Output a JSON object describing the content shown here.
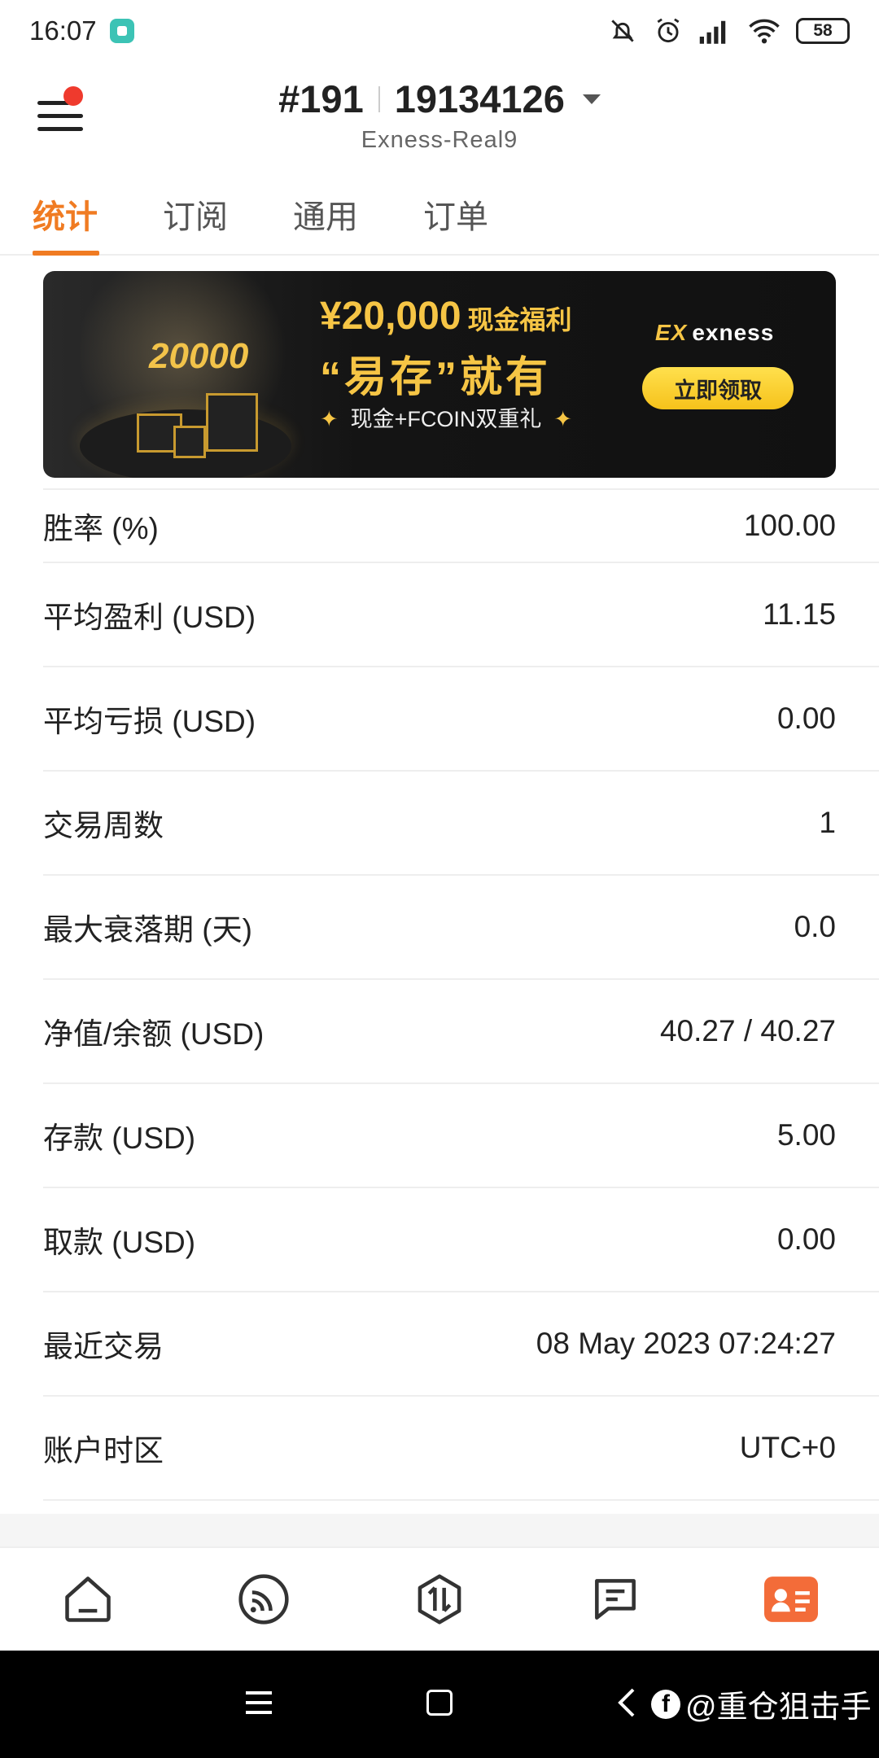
{
  "status_bar": {
    "time": "16:07",
    "battery": "58"
  },
  "header": {
    "account_prefix": "#191",
    "account_number": "19134126",
    "server": "Exness-Real9"
  },
  "tabs": [
    {
      "label": "统计",
      "active": true
    },
    {
      "label": "订阅",
      "active": false
    },
    {
      "label": "通用",
      "active": false
    },
    {
      "label": "订单",
      "active": false
    }
  ],
  "banner": {
    "amount": "¥20,000",
    "amount_suffix": "现金福利",
    "slogan": "“易存”就有",
    "subtitle": "现金+FCOIN双重礼",
    "coin_text": "20000",
    "brand": "exness",
    "cta": "立即领取"
  },
  "stats": [
    {
      "label": "胜率 (%)",
      "value": "100.00"
    },
    {
      "label": "平均盈利 (USD)",
      "value": "11.15"
    },
    {
      "label": "平均亏损 (USD)",
      "value": "0.00"
    },
    {
      "label": "交易周数",
      "value": "1"
    },
    {
      "label": "最大衰落期 (天)",
      "value": "0.0"
    },
    {
      "label": "净值/余额 (USD)",
      "value": "40.27 / 40.27"
    },
    {
      "label": "存款 (USD)",
      "value": "5.00"
    },
    {
      "label": "取款 (USD)",
      "value": "0.00"
    },
    {
      "label": "最近交易",
      "value": "08 May 2023 07:24:27"
    },
    {
      "label": "账户时区",
      "value": "UTC+0"
    }
  ],
  "bottom_nav": [
    {
      "icon": "home-icon",
      "active": false
    },
    {
      "icon": "signal-icon",
      "active": false
    },
    {
      "icon": "trade-icon",
      "active": false
    },
    {
      "icon": "message-icon",
      "active": false
    },
    {
      "icon": "profile-card-icon",
      "active": true
    }
  ],
  "watermark": "@重仓狙击手",
  "colors": {
    "accent": "#f07b22",
    "badge_red": "#ef3a2d",
    "banner_gold": "#f6c545"
  }
}
